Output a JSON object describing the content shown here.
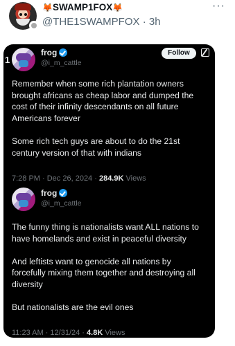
{
  "post": {
    "display_name": "SWAMP1FOX",
    "handle": "@THE1SWAMPFOX",
    "time": "3h",
    "more_icon": "ellipsis-icon"
  },
  "card": {
    "edge_number": "1",
    "tweets": [
      {
        "name": "frog",
        "handle": "@i_m_cattle",
        "follow_label": "Follow",
        "paragraphs": [
          [
            "Remember when some rich plantation owners",
            "brought africans as cheap labor and dumped the",
            "cost of their infinity descendants on all future",
            "Americans forever"
          ],
          [
            "Some rich tech guys are about to do the 21st",
            "century version of that with indians"
          ]
        ],
        "timestamp": "7:28 PM · Dec 26, 2024 · ",
        "views_count": "284.9K",
        "views_label": " Views"
      },
      {
        "name": "frog",
        "handle": "@i_m_cattle",
        "paragraphs": [
          [
            "The funny thing is nationalists want ALL nations to",
            "have homelands and exist in peaceful diversity"
          ],
          [
            "And leftists want to genocide all nations by",
            "forcefully mixing them together and destroying all",
            "diversity"
          ],
          [
            "But nationalists are the evil ones"
          ]
        ],
        "timestamp": "11:23 AM · 12/31/24 · ",
        "views_count": "4.8K",
        "views_label": " Views"
      }
    ]
  }
}
